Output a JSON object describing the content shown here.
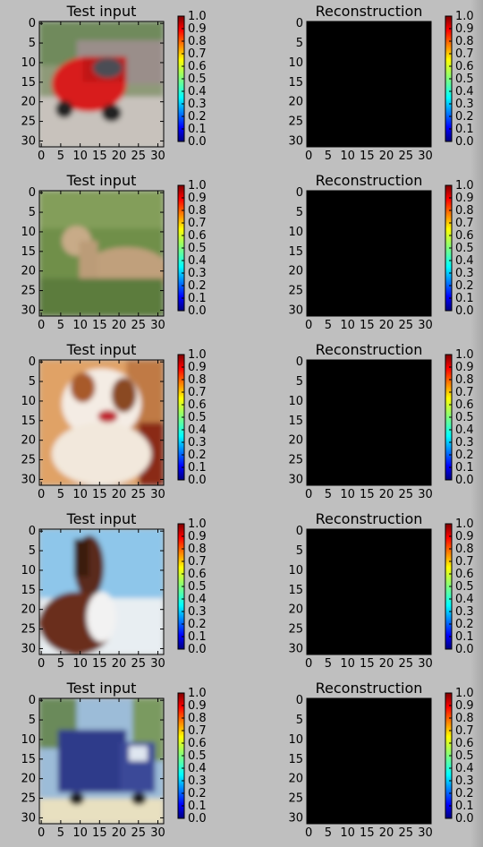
{
  "chart_data": {
    "type": "image-grid",
    "rows": 5,
    "panels": [
      {
        "title": "Test input",
        "content": "car",
        "row": 1
      },
      {
        "title": "Reconstruction",
        "content": "black",
        "row": 1
      },
      {
        "title": "Test input",
        "content": "deer",
        "row": 2
      },
      {
        "title": "Reconstruction",
        "content": "black",
        "row": 2
      },
      {
        "title": "Test input",
        "content": "dog",
        "row": 3
      },
      {
        "title": "Reconstruction",
        "content": "black",
        "row": 3
      },
      {
        "title": "Test input",
        "content": "horse",
        "row": 4
      },
      {
        "title": "Reconstruction",
        "content": "black",
        "row": 4
      },
      {
        "title": "Test input",
        "content": "truck",
        "row": 5
      },
      {
        "title": "Reconstruction",
        "content": "black",
        "row": 5
      }
    ],
    "x_ticks": [
      0,
      5,
      10,
      15,
      20,
      25,
      30
    ],
    "y_ticks": [
      0,
      5,
      10,
      15,
      20,
      25,
      30
    ],
    "xlim": [
      -0.5,
      31.5
    ],
    "ylim": [
      31.5,
      -0.5
    ],
    "colorbar": {
      "ticks": [
        "0.0",
        "0.1",
        "0.2",
        "0.3",
        "0.4",
        "0.5",
        "0.6",
        "0.7",
        "0.8",
        "0.9",
        "1.0"
      ],
      "range": [
        0,
        1
      ],
      "colormap": "jet"
    },
    "colors": {
      "background": "#bfbfbf",
      "reconstruction": "#000000"
    }
  }
}
